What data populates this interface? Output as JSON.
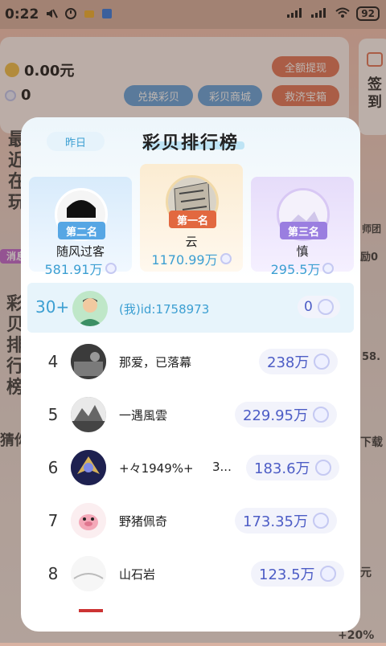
{
  "status": {
    "time": "0:22",
    "battery": "92"
  },
  "background": {
    "coin_amount": "0.00元",
    "shell_amount": "0",
    "withdraw_btn": "全额提现",
    "exchange_btn": "兑换彩贝",
    "mall_btn": "彩贝商城",
    "rescue_btn": "救济宝箱",
    "signin_label": "签到",
    "side_text_left_top": "最近在玩",
    "side_text_left_mid": "彩贝排行榜",
    "side_badge": "消息",
    "side_right_text": "师团",
    "side_right_reward": "励0",
    "side_right_value": "58.",
    "side_bottom_left": "猜你",
    "side_bottom_right": "下载",
    "promo": "+20%",
    "side_right_bottom": "元"
  },
  "modal": {
    "tab": "昨日",
    "title": "彩贝排行榜",
    "podium": [
      {
        "badge": "第二名",
        "name": "随风过客",
        "score": "581.91万"
      },
      {
        "badge": "第一名",
        "name": "云",
        "score": "1170.99万"
      },
      {
        "badge": "第三名",
        "name": "慎",
        "score": "295.5万"
      }
    ],
    "me": {
      "rank": "30+",
      "name": "(我)id:1758973",
      "score": "0"
    },
    "rows": [
      {
        "rank": "4",
        "name": "那爱，已落幕",
        "score": "238万"
      },
      {
        "rank": "5",
        "name": "一遇風雲",
        "score": "229.95万"
      },
      {
        "rank": "6",
        "name": "+々1949%+",
        "extra": "3...",
        "score": "183.6万"
      },
      {
        "rank": "7",
        "name": "野猪佩奇",
        "score": "173.35万"
      },
      {
        "rank": "8",
        "name": "山石岩",
        "score": "123.5万"
      }
    ]
  }
}
